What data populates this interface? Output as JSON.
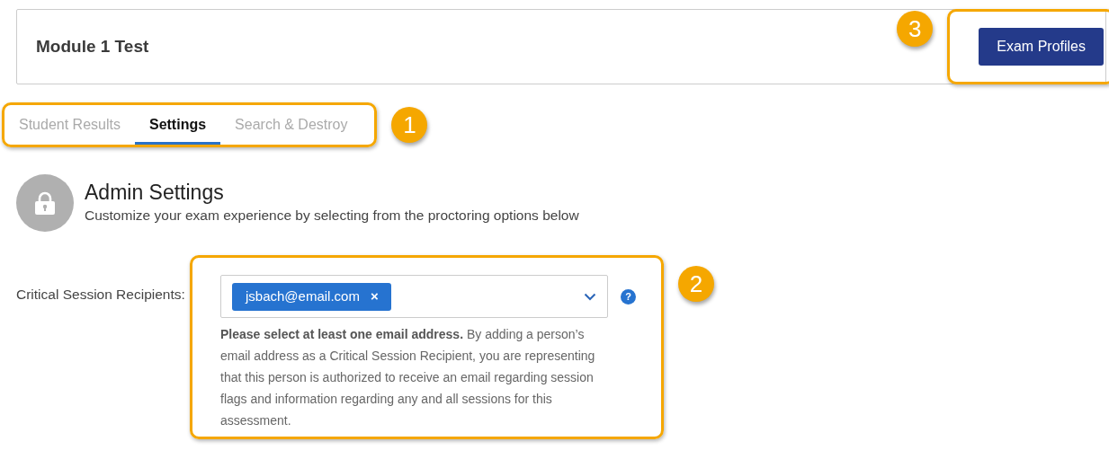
{
  "header": {
    "title": "Module 1 Test",
    "button": "Exam Profiles"
  },
  "tabs": [
    {
      "label": "Student Results",
      "selected": false
    },
    {
      "label": "Settings",
      "selected": true
    },
    {
      "label": "Search & Destroy",
      "selected": false
    }
  ],
  "section": {
    "title": "Admin Settings",
    "subtitle": "Customize your exam experience by selecting from the proctoring options below"
  },
  "field": {
    "label": "Critical Session Recipients:",
    "chips": [
      {
        "label": "jsbach@email.com",
        "remove": "×"
      }
    ],
    "help": "?",
    "note": "**Please select at least one email address.** By adding a person’s email address as a Critical Session Recipient, you are representing that this person is authorized to receive an email regarding session flags and information regarding any and all sessions for this assessment."
  },
  "callouts": [
    {
      "number": "1"
    },
    {
      "number": "2"
    },
    {
      "number": "3"
    }
  ]
}
